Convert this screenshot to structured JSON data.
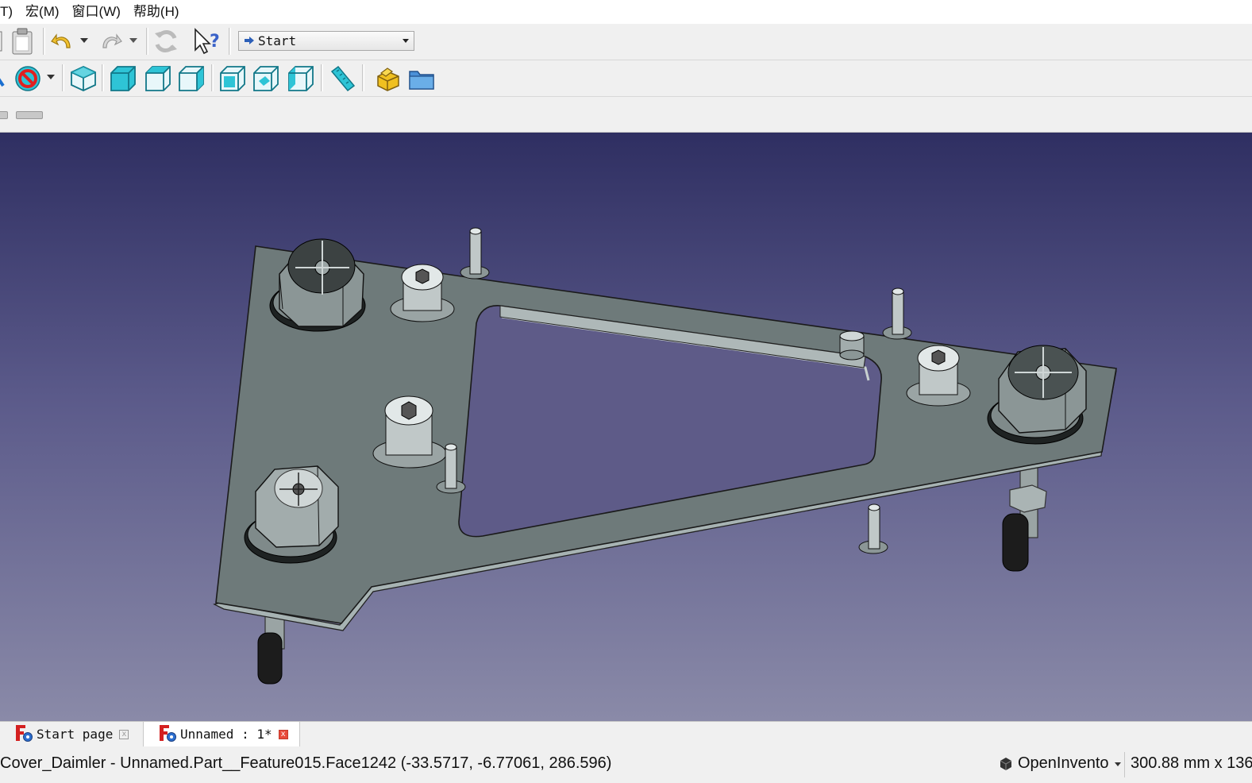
{
  "menubar": {
    "items": [
      "T)",
      "宏(M)",
      "窗口(W)",
      "帮助(H)"
    ]
  },
  "toolbar": {
    "workbench_selector": {
      "value": "Start"
    }
  },
  "tabs": [
    {
      "label": "Start page",
      "close": "x"
    },
    {
      "label": "Unnamed : 1*",
      "close": "x"
    }
  ],
  "status": {
    "message": "Cover_Daimler - Unnamed.Part__Feature015.Face1242 (-33.5717, -6.77061, 286.596)",
    "navigation_style": "OpenInvento",
    "dimensions": "300.88 mm x 136"
  },
  "colors": {
    "viewport_top": "#2f2f62",
    "viewport_bottom": "#8a8aa8",
    "part_fill": "#6e7a7a",
    "view_icon_cyan": "#2ec4d6",
    "tab_close_red": "#e84a3a"
  }
}
